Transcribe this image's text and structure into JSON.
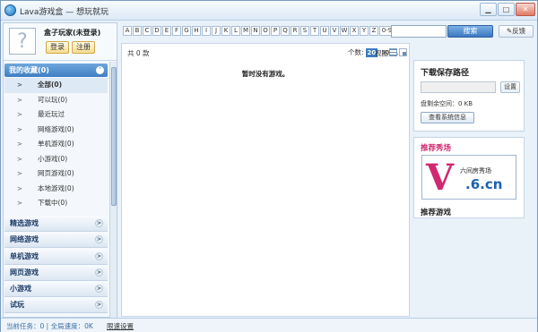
{
  "window": {
    "title": "Lava游戏盒 — 想玩就玩",
    "min": "▁",
    "max": "□",
    "close": "✕"
  },
  "user": {
    "avatar_glyph": "?",
    "name": "盒子玩家(未登录)",
    "login": "登录",
    "register": "注册"
  },
  "favorites": {
    "header": "我的收藏(0)",
    "collapse_glyph": "˄",
    "items": [
      {
        "label": "全部(0)"
      },
      {
        "label": "可以玩(0)"
      },
      {
        "label": "最近玩过"
      },
      {
        "label": "网络游戏(0)"
      },
      {
        "label": "单机游戏(0)"
      },
      {
        "label": "小游戏(0)"
      },
      {
        "label": "网页游戏(0)"
      },
      {
        "label": "本地游戏(0)"
      },
      {
        "label": "下载中(0)"
      }
    ]
  },
  "categories": [
    {
      "label": "精选游戏"
    },
    {
      "label": "网络游戏"
    },
    {
      "label": "单机游戏"
    },
    {
      "label": "网页游戏"
    },
    {
      "label": "小游戏"
    },
    {
      "label": "试玩"
    }
  ],
  "letters": [
    "A",
    "B",
    "C",
    "D",
    "E",
    "F",
    "G",
    "H",
    "I",
    "J",
    "K",
    "L",
    "M",
    "N",
    "O",
    "P",
    "Q",
    "R",
    "S",
    "T",
    "U",
    "V",
    "W",
    "X",
    "Y",
    "Z",
    "0-9"
  ],
  "search": {
    "button": "搜索",
    "feedback": "反馈"
  },
  "main": {
    "count": "共 0 款",
    "perpage_label": "个数:",
    "perpage_options": [
      "20",
      "50",
      "100"
    ],
    "perpage_active": "20",
    "view_label": "视图:",
    "empty": "暂时没有游戏。"
  },
  "download": {
    "title": "下载保存路径",
    "set": "设置",
    "disk": "盘剩余空间：0 KB",
    "sysinfo": "查看系统信息"
  },
  "promo": {
    "title": "推荐秀场",
    "logo_v": "V",
    "logo_text": "六间房秀场",
    "logo_url": ".6.cn",
    "recommend": "推荐游戏"
  },
  "status": {
    "text": "当前任务：0  |  全局速度：0K",
    "speed_link": "限速设置"
  },
  "colors": {
    "accent": "#3e7ec3",
    "promo": "#d1286f"
  }
}
